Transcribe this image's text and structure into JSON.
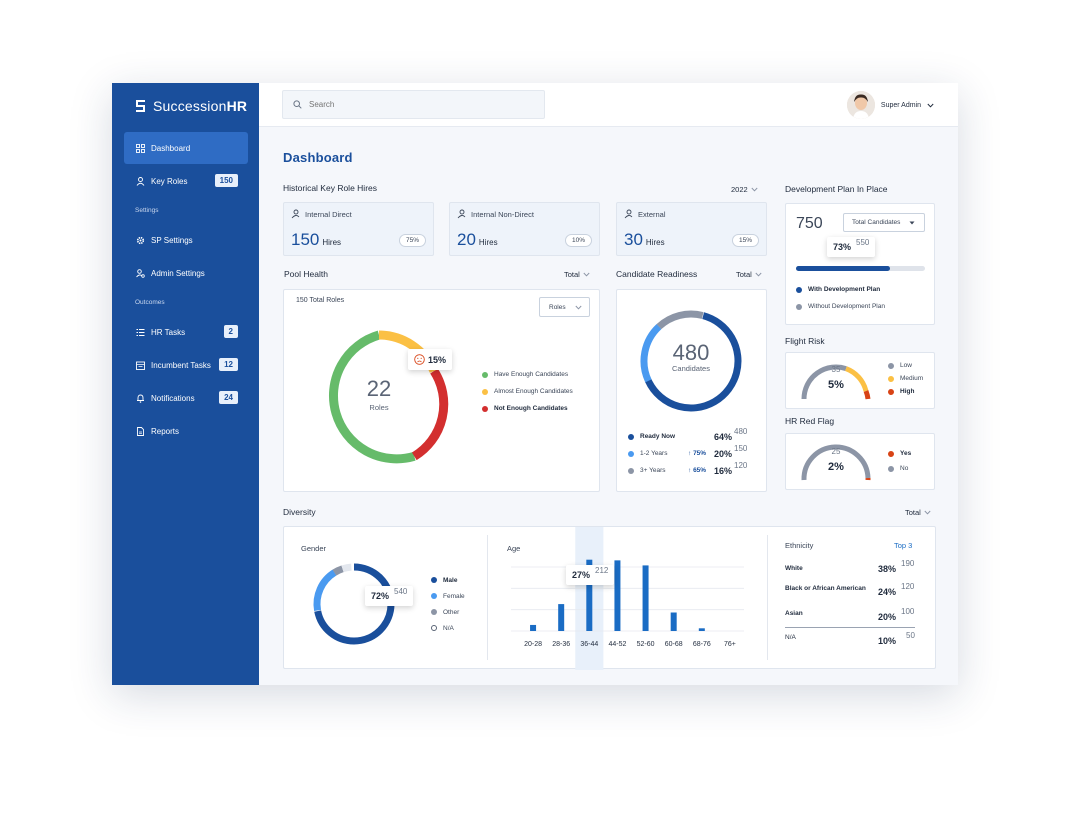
{
  "app": {
    "logo_prefix": "Succession",
    "logo_bold": "HR"
  },
  "sidebar": {
    "items": [
      {
        "label": "Dashboard",
        "icon": "dashboard-icon"
      },
      {
        "label": "Key Roles",
        "icon": "people-icon",
        "badge": "150"
      },
      {
        "label": "SP Settings",
        "icon": "gear-icon"
      },
      {
        "label": "Admin Settings",
        "icon": "admin-icon"
      },
      {
        "label": "HR Tasks",
        "icon": "list-icon",
        "badge": "2"
      },
      {
        "label": "Incumbent Tasks",
        "icon": "calendar-icon",
        "badge": "12"
      },
      {
        "label": "Notifications",
        "icon": "bell-icon",
        "badge": "24"
      },
      {
        "label": "Reports",
        "icon": "document-icon"
      }
    ],
    "sections": {
      "settings": "Settings",
      "outcomes": "Outcomes"
    }
  },
  "topbar": {
    "search_placeholder": "Search",
    "user_name": "Super Admin"
  },
  "page_title": "Dashboard",
  "historical": {
    "title": "Historical Key Role Hires",
    "year": "2022",
    "cards": [
      {
        "label": "Internal Direct",
        "value": "150",
        "unit": "Hires",
        "pct": "75%"
      },
      {
        "label": "Internal Non-Direct",
        "value": "20",
        "unit": "Hires",
        "pct": "10%"
      },
      {
        "label": "External",
        "value": "30",
        "unit": "Hires",
        "pct": "15%"
      }
    ]
  },
  "pool_health": {
    "title": "Pool Health",
    "filter": "Total",
    "subtitle": "150 Total Roles",
    "dropdown": "Roles",
    "center_value": "22",
    "center_label": "Roles",
    "tooltip": "15%",
    "legend": [
      {
        "label": "Have Enough Candidates",
        "color": "#66bb6a"
      },
      {
        "label": "Almost Enough Candidates",
        "color": "#fbc044"
      },
      {
        "label": "Not Enough Candidates",
        "color": "#d32f2f"
      }
    ]
  },
  "candidate_readiness": {
    "title": "Candidate Readiness",
    "filter": "Total",
    "center_value": "480",
    "center_label": "Candidates",
    "rows": [
      {
        "label": "Ready Now",
        "pct": "64%",
        "count": "480",
        "color": "#1a4f9c",
        "trend": ""
      },
      {
        "label": "1-2 Years",
        "pct": "20%",
        "count": "150",
        "color": "#4a9af0",
        "trend": "75%"
      },
      {
        "label": "3+ Years",
        "pct": "16%",
        "count": "120",
        "color": "#8c95a6",
        "trend": "65%"
      }
    ]
  },
  "dev_plan": {
    "title": "Development Plan In Place",
    "value": "750",
    "dropdown": "Total Candidates",
    "tooltip_pct": "73%",
    "tooltip_count": "550",
    "progress": 0.73,
    "legend": [
      {
        "label": "With Development Plan",
        "color": "#1a4f9c"
      },
      {
        "label": "Without Development Plan",
        "color": "#8c95a6"
      }
    ]
  },
  "flight_risk": {
    "title": "Flight Risk",
    "count": "35",
    "pct": "5%",
    "legend": [
      {
        "label": "Low",
        "color": "#8c95a6"
      },
      {
        "label": "Medium",
        "color": "#fbc044"
      },
      {
        "label": "High",
        "color": "#d84315"
      }
    ]
  },
  "hr_red_flag": {
    "title": "HR Red Flag",
    "count": "25",
    "pct": "2%",
    "legend": [
      {
        "label": "Yes",
        "color": "#d84315"
      },
      {
        "label": "No",
        "color": "#8c95a6"
      }
    ]
  },
  "diversity": {
    "title": "Diversity",
    "filter": "Total",
    "gender": {
      "title": "Gender",
      "tooltip_pct": "72%",
      "tooltip_count": "540",
      "legend": [
        {
          "label": "Male",
          "color": "#1a4f9c"
        },
        {
          "label": "Female",
          "color": "#4a9af0"
        },
        {
          "label": "Other",
          "color": "#8c95a6"
        },
        {
          "label": "N/A",
          "color": "#ffffff"
        }
      ]
    },
    "age": {
      "title": "Age",
      "tooltip_pct": "27%",
      "tooltip_count": "212"
    },
    "ethnicity": {
      "title": "Ethnicity",
      "link": "Top 3",
      "rows": [
        {
          "label": "White",
          "pct": "38%",
          "count": "190"
        },
        {
          "label": "Black or African American",
          "pct": "24%",
          "count": "120"
        },
        {
          "label": "Asian",
          "pct": "20%",
          "count": "100"
        },
        {
          "label": "N/A",
          "pct": "10%",
          "count": "50"
        }
      ]
    }
  },
  "chart_data": {
    "type": "bar",
    "title": "Age",
    "categories": [
      "20-28",
      "28-36",
      "36-44",
      "44-52",
      "52-60",
      "60-68",
      "68-76",
      "76+"
    ],
    "values": [
      18,
      80,
      212,
      210,
      195,
      55,
      8,
      0
    ],
    "highlight": "36-44",
    "ylim": [
      0,
      220
    ],
    "grid": true,
    "color": "#1a6cc4"
  }
}
